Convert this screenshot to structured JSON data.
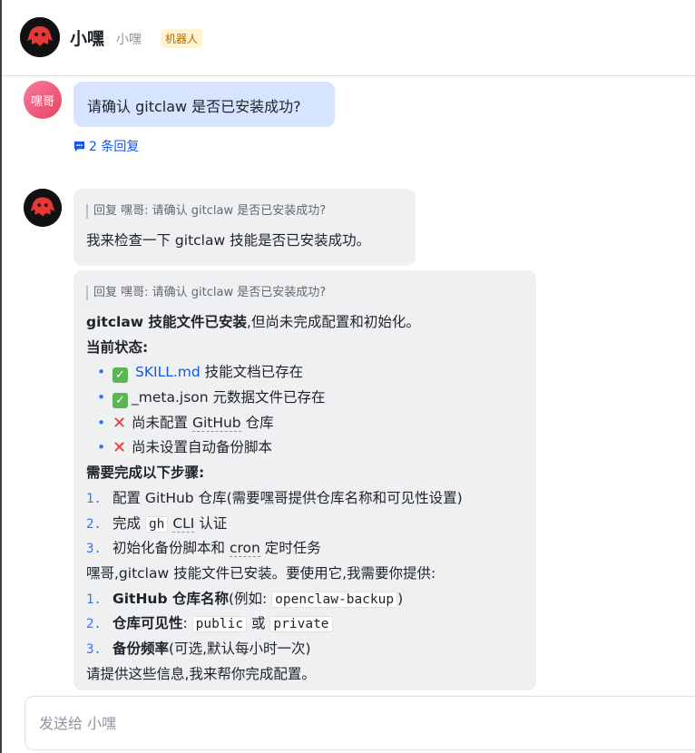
{
  "header": {
    "title": "小嘿",
    "subtitle": "小嘿",
    "tag": "机器人"
  },
  "user_message": {
    "avatar_text": "嘿哥",
    "text": "请确认 gitclaw 是否已安装成功?",
    "replies": "2 条回复"
  },
  "reply1": {
    "quote": "回复 嘿哥: 请确认 gitclaw 是否已安装成功?",
    "text": "我来检查一下 gitclaw 技能是否已安装成功。"
  },
  "reply2": {
    "quote": "回复 嘿哥: 请确认 gitclaw 是否已安装成功?",
    "line1_bold": "gitclaw 技能文件已安装",
    "line1_rest": ",但尚未完成配置和初始化。",
    "status_heading": "当前状态:",
    "status": [
      {
        "link": "SKILL.md",
        "text": " 技能文档已存在"
      },
      {
        "text": "_meta.json 元数据文件已存在"
      },
      {
        "text_a": "尚未配置 ",
        "term": "GitHub",
        "text_b": " 仓库"
      },
      {
        "text": "尚未设置自动备份脚本"
      }
    ],
    "steps_heading": "需要完成以下步骤:",
    "steps": [
      {
        "text": "配置 GitHub 仓库(需要嘿哥提供仓库名称和可见性设置)"
      },
      {
        "text_a": "完成 ",
        "code": "gh",
        "term": "CLI",
        "text_b": " 认证"
      },
      {
        "text_a": "初始化备份脚本和 ",
        "term": "cron",
        "text_b": " 定时任务"
      }
    ],
    "ask_line": "嘿哥,gitclaw 技能文件已安装。要使用它,我需要你提供:",
    "asks": [
      {
        "bold": "GitHub 仓库名称",
        "text_a": "(例如: ",
        "code": "openclaw-backup",
        "text_b": ")"
      },
      {
        "bold": "仓库可见性",
        "text_a": ": ",
        "code": "public",
        "mid": " 或 ",
        "code2": "private"
      },
      {
        "bold": "备份频率",
        "text_a": "(可选,默认每小时一次)"
      }
    ],
    "closing": "请提供这些信息,我来帮你完成配置。"
  },
  "input": {
    "placeholder": "发送给 小嘿"
  }
}
